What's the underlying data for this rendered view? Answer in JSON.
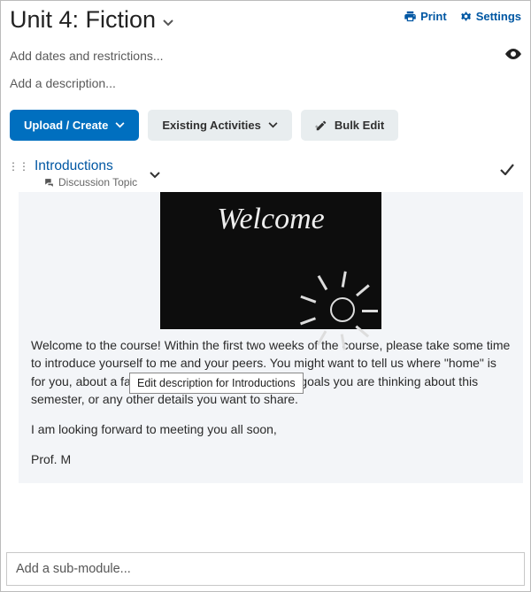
{
  "header": {
    "title": "Unit 4: Fiction",
    "print_label": "Print",
    "settings_label": "Settings"
  },
  "placeholders": {
    "dates": "Add dates and restrictions...",
    "description": "Add a description...",
    "sub_module": "Add a sub-module..."
  },
  "toolbar": {
    "upload_create": "Upload / Create",
    "existing_activities": "Existing Activities",
    "bulk_edit": "Bulk Edit"
  },
  "topic": {
    "title": "Introductions",
    "type_label": "Discussion Topic",
    "image_text": "Welcome",
    "tooltip": "Edit description for Introductions",
    "paragraph1": "Welcome to the course! Within the first two weeks of the course, please take some time to introduce yourself to me and your peers. You might want to tell us where \"home\" is for you, about a favorite hobby/activity you have, goals you are thinking about this semester, or any other details you want to share.",
    "paragraph2": "I am looking forward to meeting you all soon,",
    "signature": "Prof. M"
  }
}
